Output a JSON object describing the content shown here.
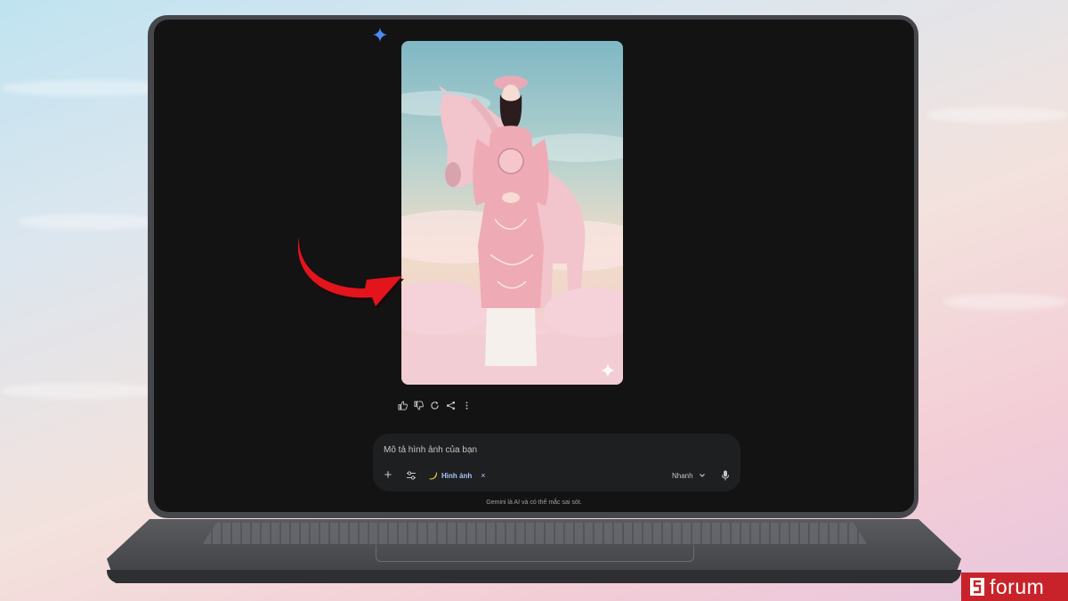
{
  "prompt": {
    "placeholder": "Mô tả hình ảnh của bạn",
    "chip_label": "Hình ảnh",
    "chip_close": "×",
    "mode": "Nhanh",
    "plus": "+"
  },
  "disclaimer": "Gemini là AI và có thể mắc sai sót.",
  "brand": {
    "name": "forum"
  },
  "icons": {
    "gemini": "gemini-star-icon",
    "actions": [
      "thumbs-up-icon",
      "thumbs-down-icon",
      "regenerate-icon",
      "share-icon",
      "more-vert-icon"
    ],
    "tools": "tools-sliders-icon",
    "chip": "banana-icon",
    "mic": "mic-icon",
    "sparkle": "sparkle-watermark-icon"
  },
  "colors": {
    "screen_bg": "#131314",
    "prompt_bg": "#1e1f20",
    "chip_text": "#a8c7fa",
    "gemini_blue": "#4a8cf7",
    "arrow_red": "#e3141c",
    "brand_red": "#c8232a"
  }
}
